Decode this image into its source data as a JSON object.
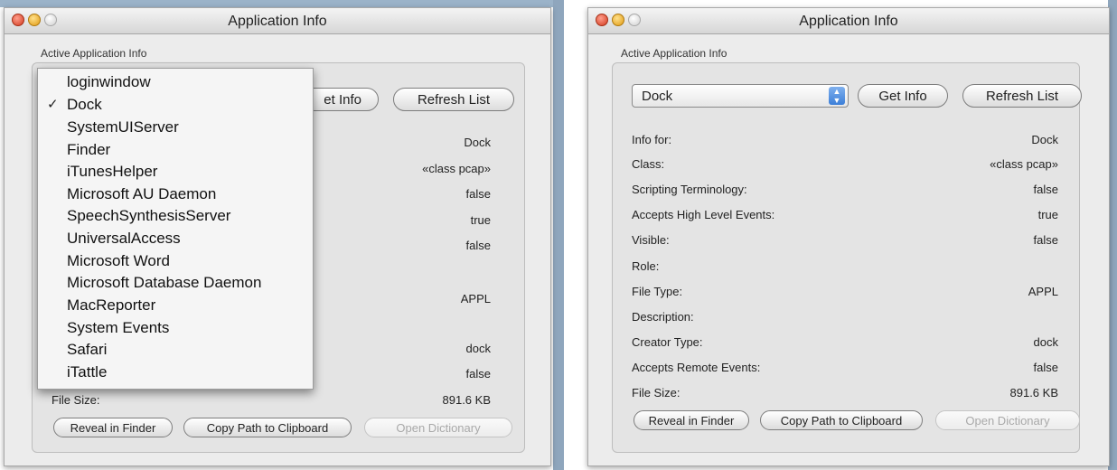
{
  "window_title": "Application Info",
  "group_label": "Active Application Info",
  "popup": {
    "selected": "Dock"
  },
  "buttons": {
    "get_info": "Get Info",
    "get_info_partial": "et Info",
    "refresh_list": "Refresh List",
    "reveal_in_finder": "Reveal in Finder",
    "copy_path": "Copy Path to Clipboard",
    "open_dictionary": "Open Dictionary"
  },
  "menu": {
    "checked": "Dock",
    "items": [
      "loginwindow",
      "Dock",
      "SystemUIServer",
      "Finder",
      "iTunesHelper",
      "Microsoft AU Daemon",
      "SpeechSynthesisServer",
      "UniversalAccess",
      "Microsoft Word",
      "Microsoft Database Daemon",
      "MacReporter",
      "System Events",
      "Safari",
      "iTattle"
    ]
  },
  "info_rows": [
    {
      "label": "Info for:",
      "value": "Dock"
    },
    {
      "label": "Class:",
      "value": "«class pcap»"
    },
    {
      "label": "Scripting Terminology:",
      "value": "false"
    },
    {
      "label": "Accepts High Level Events:",
      "value": "true"
    },
    {
      "label": "Visible:",
      "value": "false"
    },
    {
      "label": "Role:",
      "value": ""
    },
    {
      "label": "File Type:",
      "value": "APPL"
    },
    {
      "label": "Description:",
      "value": ""
    },
    {
      "label": "Creator Type:",
      "value": "dock"
    },
    {
      "label": "Accepts Remote Events:",
      "value": "false"
    },
    {
      "label": "File Size:",
      "value": "891.6 KB"
    }
  ]
}
